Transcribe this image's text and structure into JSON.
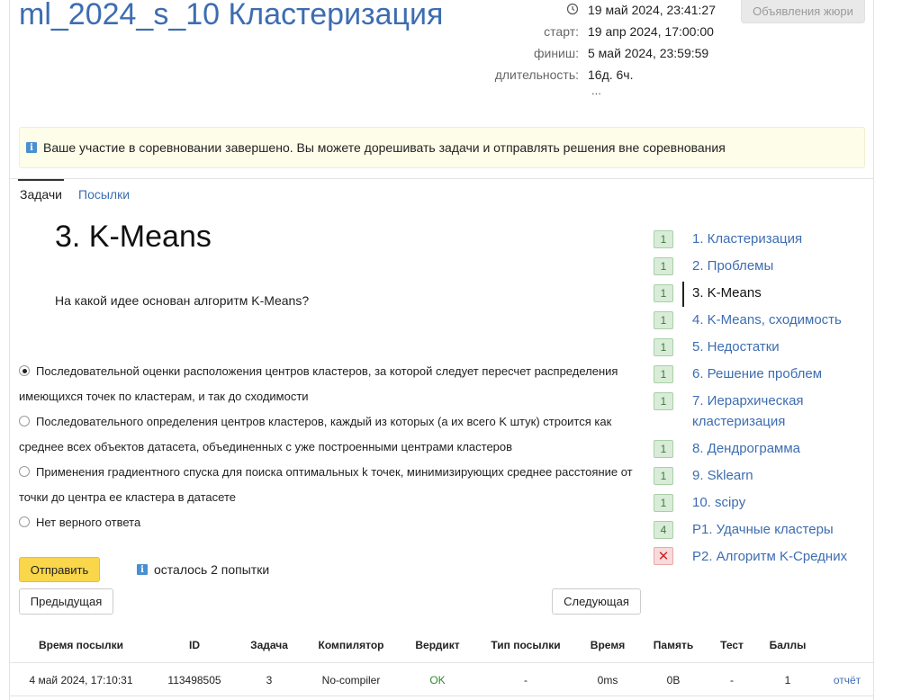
{
  "contest": {
    "title": "ml_2024_s_10 Кластеризация",
    "now": "19 май 2024, 23:41:27",
    "start_label": "старт:",
    "start": "19 апр 2024, 17:00:00",
    "finish_label": "финиш:",
    "finish": "5 май 2024, 23:59:59",
    "duration_label": "длительность:",
    "duration": "16д. 6ч.",
    "more": "...",
    "jury_button": "Объявления жюри"
  },
  "alert": {
    "icon": "info-icon",
    "text": "Ваше участие в соревновании завершено. Вы можете дорешивать задачи и отправлять решения вне соревнования"
  },
  "tabs": [
    {
      "label": "Задачи",
      "active": true
    },
    {
      "label": "Посылки",
      "active": false
    }
  ],
  "problem": {
    "title": "3. K-Means",
    "question": "На какой идее основан алгоритм K-Means?",
    "options": [
      {
        "text": "Последовательной оценки расположения центров кластеров, за которой следует пересчет распределения имеющихся точек по кластерам, и так до сходимости",
        "selected": true
      },
      {
        "text": "Последовательного определения центров кластеров, каждый из которых (а их всего K штук) строится как среднее всех объектов датасета, объединенных с уже построенными центрами кластеров",
        "selected": false
      },
      {
        "text": "Применения градиентного спуска для поиска оптимальных k точек, минимизирующих среднее расстояние от точки до центра ее кластера в датасете",
        "selected": false
      },
      {
        "text": "Нет верного ответа",
        "selected": false
      }
    ],
    "submit_label": "Отправить",
    "attempts_text": "осталось 2 попытки",
    "prev_label": "Предыдущая",
    "next_label": "Следующая"
  },
  "sidebar": {
    "items": [
      {
        "badge": "1",
        "label": "1. Кластеризация",
        "status": "ok"
      },
      {
        "badge": "1",
        "label": "2. Проблемы",
        "status": "ok"
      },
      {
        "badge": "1",
        "label": "3. K-Means",
        "status": "ok",
        "current": true
      },
      {
        "badge": "1",
        "label": "4. K-Means, сходимость",
        "status": "ok"
      },
      {
        "badge": "1",
        "label": "5. Недостатки",
        "status": "ok"
      },
      {
        "badge": "1",
        "label": "6. Решение проблем",
        "status": "ok"
      },
      {
        "badge": "1",
        "label": "7. Иерархическая кластеризация",
        "status": "ok"
      },
      {
        "badge": "1",
        "label": "8. Дендрограмма",
        "status": "ok"
      },
      {
        "badge": "1",
        "label": "9. Sklearn",
        "status": "ok"
      },
      {
        "badge": "1",
        "label": "10. scipy",
        "status": "ok"
      },
      {
        "badge": "4",
        "label": "P1. Удачные кластеры",
        "status": "ok"
      },
      {
        "badge": "✕",
        "label": "P2. Алгоритм K-Средних",
        "status": "fail"
      }
    ]
  },
  "submissions": {
    "columns": [
      "Время посылки",
      "ID",
      "Задача",
      "Компилятор",
      "Вердикт",
      "Тип посылки",
      "Время",
      "Память",
      "Тест",
      "Баллы"
    ],
    "rows": [
      {
        "time": "4 май 2024, 17:10:31",
        "id": "113498505",
        "task": "3",
        "compiler": "No-compiler",
        "verdict": "OK",
        "type": "-",
        "runtime": "0ms",
        "memory": "0B",
        "test": "-",
        "score": "1",
        "report": "отчёт"
      }
    ]
  },
  "colors": {
    "accent": "#3d6db1",
    "submit": "#f9d64a",
    "ok_badge": "#d8ecd8",
    "fail_badge": "#f8dada",
    "verdict_ok": "#2e8b2e"
  }
}
